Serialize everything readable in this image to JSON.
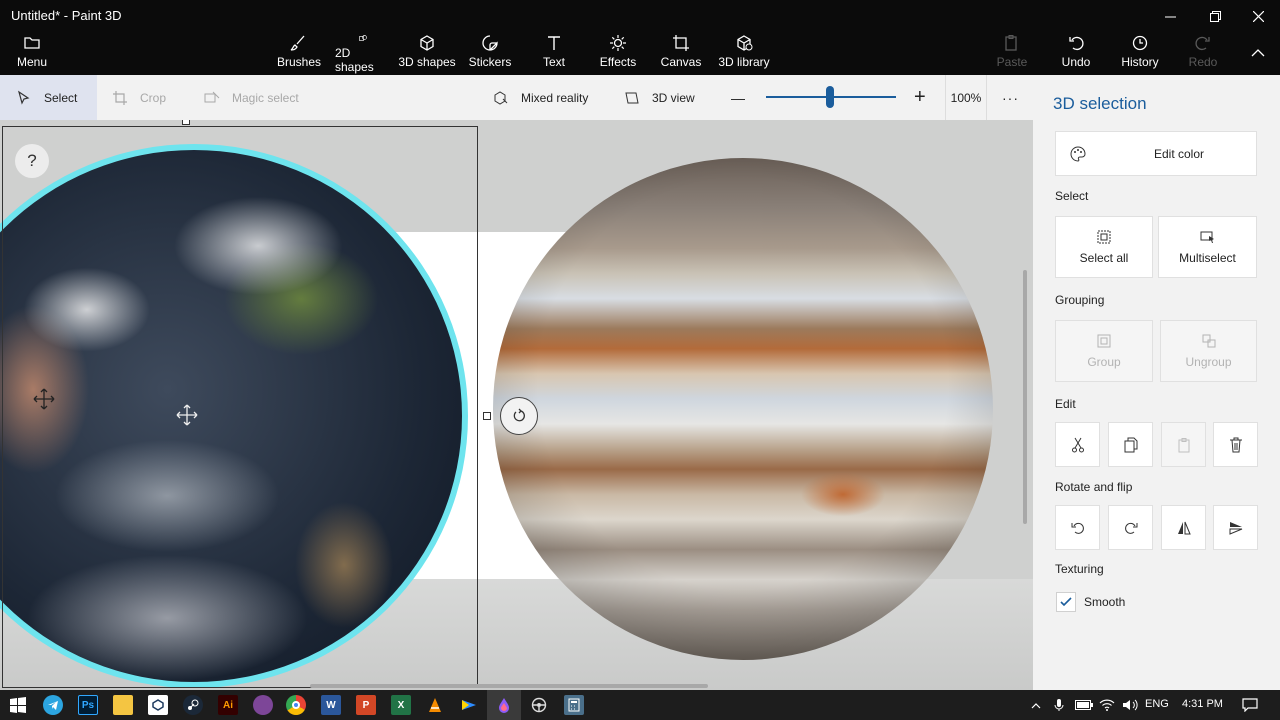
{
  "window": {
    "title": "Untitled* - Paint 3D",
    "controls": {
      "minimize": "minimize-icon",
      "maximize": "maximize-icon",
      "close": "close-icon"
    }
  },
  "ribbon": {
    "menu": "Menu",
    "tools": [
      "Brushes",
      "2D shapes",
      "3D shapes",
      "Stickers",
      "Text",
      "Effects",
      "Canvas",
      "3D library"
    ],
    "paste": "Paste",
    "undo": "Undo",
    "history": "History",
    "redo": "Redo"
  },
  "commandbar": {
    "select": "Select",
    "crop": "Crop",
    "magic_select": "Magic select",
    "mixed_reality": "Mixed reality",
    "view_3d": "3D view",
    "zoom_minus": "—",
    "zoom_plus": "+",
    "zoom_level": "100%",
    "zoom_fraction": 0.5,
    "more": "···"
  },
  "canvas": {
    "help": "?",
    "objects": [
      "earth-sphere",
      "jupiter-sphere"
    ]
  },
  "panel": {
    "title": "3D selection",
    "edit_color": "Edit color",
    "select_label": "Select",
    "select_all": "Select all",
    "multiselect": "Multiselect",
    "grouping_label": "Grouping",
    "group": "Group",
    "ungroup": "Ungroup",
    "edit_label": "Edit",
    "rotate_label": "Rotate and flip",
    "texturing_label": "Texturing",
    "smooth": "Smooth",
    "smooth_checked": true
  },
  "taskbar": {
    "apps": [
      "start-icon",
      "telegram-icon",
      "photoshop-icon",
      "file-explorer-icon",
      "app-icon",
      "steam-icon",
      "illustrator-icon",
      "tor-icon",
      "chrome-icon",
      "word-icon",
      "powerpoint-icon",
      "excel-icon",
      "vlc-icon",
      "arrow-app-icon",
      "paint3d-icon",
      "steering-icon",
      "calculator-icon"
    ],
    "ps": "Ps",
    "ai": "Ai",
    "w": "W",
    "p": "P",
    "x": "X",
    "language": "ENG",
    "time": "4:31 PM"
  }
}
